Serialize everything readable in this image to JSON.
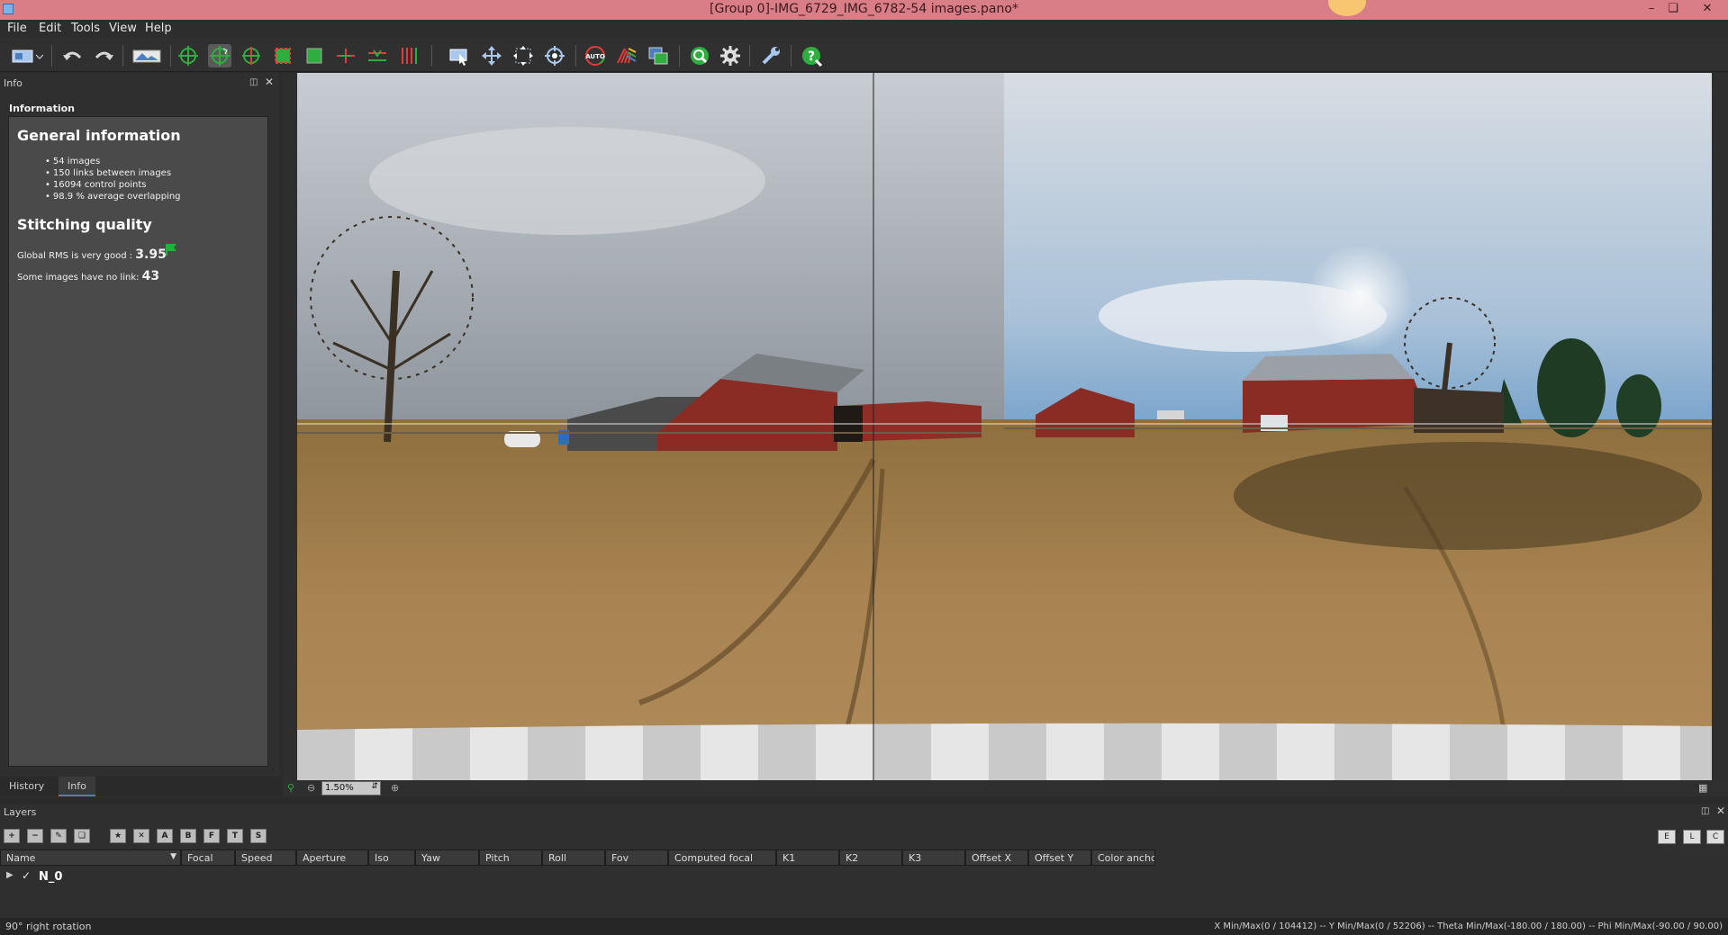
{
  "window": {
    "title": "[Group 0]-IMG_6729_IMG_6782-54 images.pano*",
    "buttons": [
      "–",
      "❏",
      "✕"
    ]
  },
  "menu": [
    "File",
    "Edit",
    "Tools",
    "View",
    "Help"
  ],
  "toolbar": {
    "icons": [
      "layout-icon",
      "undo-icon",
      "redo-icon",
      "panorama-preview-icon",
      "move-icon",
      "rotate-icon",
      "straighten-icon",
      "crop-icon",
      "fit-icon",
      "horizon-icon",
      "level-icon",
      "verticals-icon",
      "selection-icon",
      "pan-icon",
      "grid-icon",
      "center-icon",
      "auto-icon",
      "color-icon",
      "blend-icon",
      "render-icon",
      "settings-icon",
      "tools-icon",
      "help-icon"
    ],
    "auto_label": "AUTO"
  },
  "info_panel": {
    "title": "Info",
    "section": "Information",
    "general_heading": "General information",
    "stats": [
      "54 images",
      "150 links between images",
      "16094 control points",
      "98.9 % average overlapping"
    ],
    "quality_heading": "Stitching quality",
    "rms_label": "Global RMS is very good : ",
    "rms_value": "3.95",
    "nolink_label": "Some images have no link: ",
    "nolink_value": "43",
    "flag_color": "#1db43a"
  },
  "panel_tabs": [
    "History",
    "Info"
  ],
  "zoom": {
    "value": "1.50%"
  },
  "layers": {
    "title": "Layers",
    "toolbar_letters": [
      "A",
      "B",
      "F",
      "T",
      "S"
    ],
    "right_letters": [
      "E",
      "L",
      "C"
    ],
    "columns": [
      "Name",
      "Focal",
      "Speed",
      "Aperture",
      "Iso",
      "Yaw",
      "Pitch",
      "Roll",
      "Fov",
      "Computed focal",
      "K1",
      "K2",
      "K3",
      "Offset X",
      "Offset Y",
      "Color anchc"
    ],
    "rows": [
      {
        "name": "N_0"
      }
    ]
  },
  "status": {
    "left": "90° right rotation",
    "right": "X Min/Max(0 / 104412)  --  Y Min/Max(0 / 52206)  --  Theta Min/Max(-180.00 / 180.00)  --  Phi Min/Max(-90.00 / 90.00)"
  },
  "colors": {
    "titlebar": "#d97d86",
    "accent": "#4b7fbf"
  }
}
